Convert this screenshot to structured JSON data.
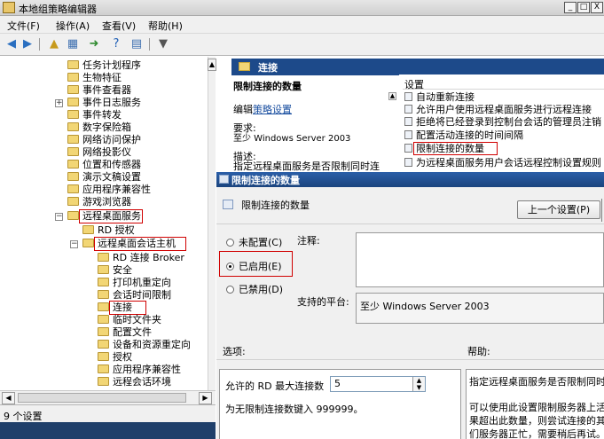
{
  "window": {
    "title": "本地组策略编辑器",
    "min": "_",
    "max": "□",
    "close": "X"
  },
  "menu": [
    "文件(F)",
    "操作(A)",
    "查看(V)",
    "帮助(H)"
  ],
  "tree": {
    "items": [
      "任务计划程序",
      "生物特征",
      "事件查看器",
      "事件日志服务",
      "事件转发",
      "数字保险箱",
      "网络访问保护",
      "网络投影仪",
      "位置和传感器",
      "演示文稿设置",
      "应用程序兼容性",
      "游戏浏览器",
      "远程桌面服务",
      "RD 授权",
      "远程桌面会话主机",
      "RD 连接 Broker",
      "安全",
      "打印机重定向",
      "会话时间限制",
      "连接",
      "临时文件夹",
      "配置文件",
      "设备和资源重定向",
      "授权",
      "应用程序兼容性",
      "远程会话环境"
    ],
    "expander_plus": "+",
    "expander_minus": "−"
  },
  "status": {
    "text": "9 个设置"
  },
  "right": {
    "header": "连接",
    "policy_title": "限制连接的数量",
    "edit_prefix": "编辑",
    "edit_link": "策略设置",
    "req_label": "要求:",
    "req_value": "至少 Windows Server 2003",
    "desc_label": "描述:",
    "desc_value": "指定远程桌面服务是否限制同时连",
    "settings_header": "设置",
    "settings": [
      "自动重新连接",
      "允许用户使用远程桌面服务进行远程连接",
      "拒绝将已经登录到控制台会话的管理员注销",
      "配置活动连接的时间间隔",
      "限制连接的数量",
      "为远程桌面服务用户会话远程控制设置规则"
    ]
  },
  "dialog": {
    "title": "限制连接的数量",
    "setting_name": "限制连接的数量",
    "prev_button": "上一个设置(P)",
    "radio_notconfigured": "未配置(C)",
    "radio_enabled": "已启用(E)",
    "radio_disabled": "已禁用(D)",
    "comment_label": "注释:",
    "platform_label": "支持的平台:",
    "platform_value": "至少 Windows Server 2003",
    "options_label": "选项:",
    "help_label": "帮助:",
    "max_conn_label": "允许的 RD 最大连接数",
    "max_conn_value": "5",
    "hint": "为无限制连接数键入 999999。",
    "help_lines": [
      "指定远程桌面服务是否限制同时",
      "可以使用此设置限制服务器上活",
      "果超出此数量，则尝试连接的其",
      "们服务器正忙，需要稍后再试。"
    ]
  }
}
